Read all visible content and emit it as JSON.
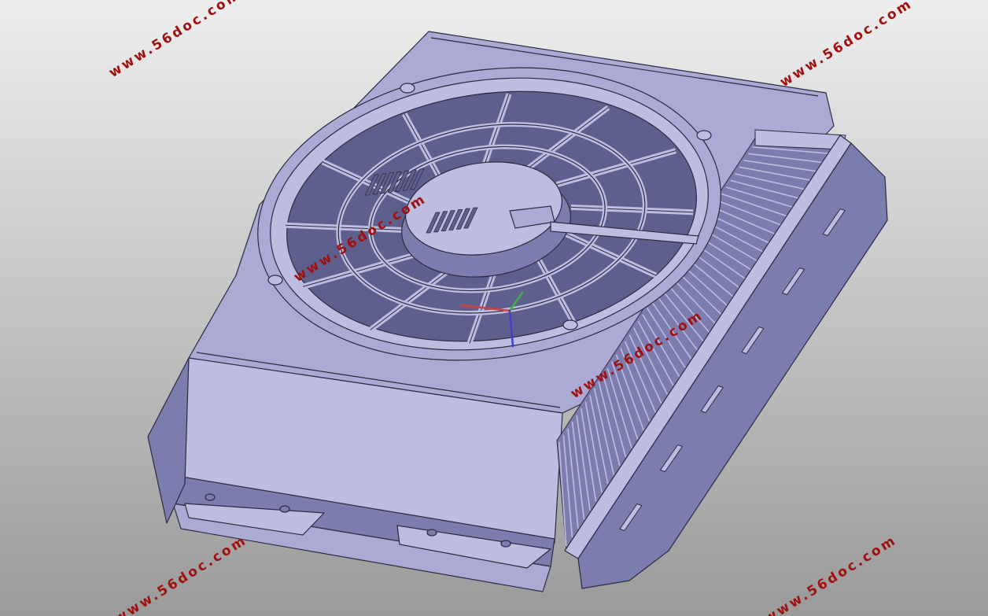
{
  "watermark": "www.56doc.com",
  "colors": {
    "background_top": "#eeeeee",
    "background_bottom": "#9a9a9a",
    "part_fill": "#aaaad4",
    "part_light": "#bdbde2",
    "part_dark": "#7c7cae",
    "part_darker": "#5f5f8e",
    "edge": "#2b2b40",
    "watermark": "#a01010",
    "axis_x": "#d04040",
    "axis_y": "#40b040",
    "axis_z": "#4040d0"
  },
  "model": {
    "fan_blade_count": 10,
    "inner_rib_count": 12,
    "heatsink_fin_count": 7,
    "radiator_slat_count": 46,
    "side_tab_count": 6
  }
}
